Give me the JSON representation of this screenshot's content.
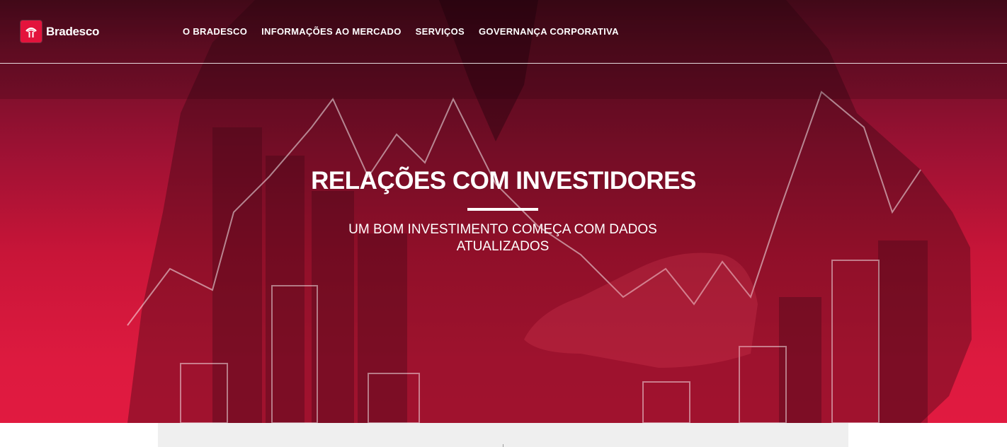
{
  "brand": {
    "name": "Bradesco",
    "logo_color": "#e3133c"
  },
  "nav": {
    "items": [
      {
        "label": "O BRADESCO"
      },
      {
        "label": "INFORMAÇÕES AO MERCADO"
      },
      {
        "label": "SERVIÇOS"
      },
      {
        "label": "GOVERNANÇA CORPORATIVA"
      }
    ]
  },
  "hero": {
    "title": "RELAÇÕES COM INVESTIDORES",
    "subtitle": "UM BOM INVESTIMENTO COMEÇA COM DADOS ATUALIZADOS",
    "accent_color": "#e11a40"
  }
}
